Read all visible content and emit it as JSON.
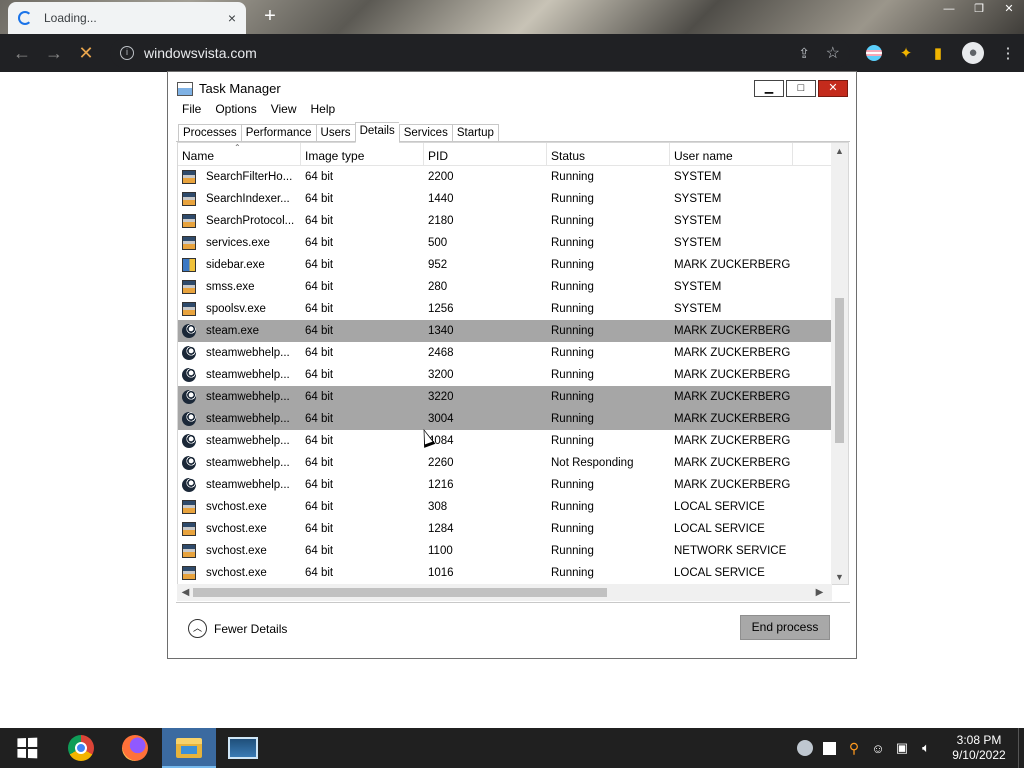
{
  "browser": {
    "tab_title": "Loading...",
    "tab_close": "×",
    "new_tab": "+",
    "url": "windowsvista.com",
    "win_min": "—",
    "win_restore": "❐",
    "win_close": "✕"
  },
  "taskmgr": {
    "title": "Task Manager",
    "menu": [
      "File",
      "Options",
      "View",
      "Help"
    ],
    "tabs": [
      "Processes",
      "Performance",
      "Users",
      "Details",
      "Services",
      "Startup"
    ],
    "active_tab": "Details",
    "columns": [
      "Name",
      "Image type",
      "PID",
      "Status",
      "User name"
    ],
    "rows": [
      {
        "icon": "system",
        "name": "SearchFilterHo...",
        "type": "64 bit",
        "pid": "2200",
        "status": "Running",
        "user": "SYSTEM",
        "selected": false
      },
      {
        "icon": "system",
        "name": "SearchIndexer...",
        "type": "64 bit",
        "pid": "1440",
        "status": "Running",
        "user": "SYSTEM",
        "selected": false
      },
      {
        "icon": "system",
        "name": "SearchProtocol...",
        "type": "64 bit",
        "pid": "2180",
        "status": "Running",
        "user": "SYSTEM",
        "selected": false
      },
      {
        "icon": "system",
        "name": "services.exe",
        "type": "64 bit",
        "pid": "500",
        "status": "Running",
        "user": "SYSTEM",
        "selected": false
      },
      {
        "icon": "sidebar",
        "name": "sidebar.exe",
        "type": "64 bit",
        "pid": "952",
        "status": "Running",
        "user": "MARK ZUCKERBERG",
        "selected": false
      },
      {
        "icon": "system",
        "name": "smss.exe",
        "type": "64 bit",
        "pid": "280",
        "status": "Running",
        "user": "SYSTEM",
        "selected": false
      },
      {
        "icon": "system",
        "name": "spoolsv.exe",
        "type": "64 bit",
        "pid": "1256",
        "status": "Running",
        "user": "SYSTEM",
        "selected": false
      },
      {
        "icon": "steam",
        "name": "steam.exe",
        "type": "64 bit",
        "pid": "1340",
        "status": "Running",
        "user": "MARK ZUCKERBERG",
        "selected": true
      },
      {
        "icon": "steam",
        "name": "steamwebhelp...",
        "type": "64 bit",
        "pid": "2468",
        "status": "Running",
        "user": "MARK ZUCKERBERG",
        "selected": false
      },
      {
        "icon": "steam",
        "name": "steamwebhelp...",
        "type": "64 bit",
        "pid": "3200",
        "status": "Running",
        "user": "MARK ZUCKERBERG",
        "selected": false
      },
      {
        "icon": "steam",
        "name": "steamwebhelp...",
        "type": "64 bit",
        "pid": "3220",
        "status": "Running",
        "user": "MARK ZUCKERBERG",
        "selected": true
      },
      {
        "icon": "steam",
        "name": "steamwebhelp...",
        "type": "64 bit",
        "pid": "3004",
        "status": "Running",
        "user": "MARK ZUCKERBERG",
        "selected": true
      },
      {
        "icon": "steam",
        "name": "steamwebhelp...",
        "type": "64 bit",
        "pid": "4084",
        "status": "Running",
        "user": "MARK ZUCKERBERG",
        "selected": false
      },
      {
        "icon": "steam",
        "name": "steamwebhelp...",
        "type": "64 bit",
        "pid": "2260",
        "status": "Not Responding",
        "user": "MARK ZUCKERBERG",
        "selected": false
      },
      {
        "icon": "steam",
        "name": "steamwebhelp...",
        "type": "64 bit",
        "pid": "1216",
        "status": "Running",
        "user": "MARK ZUCKERBERG",
        "selected": false
      },
      {
        "icon": "system",
        "name": "svchost.exe",
        "type": "64 bit",
        "pid": "308",
        "status": "Running",
        "user": "LOCAL SERVICE",
        "selected": false
      },
      {
        "icon": "system",
        "name": "svchost.exe",
        "type": "64 bit",
        "pid": "1284",
        "status": "Running",
        "user": "LOCAL SERVICE",
        "selected": false
      },
      {
        "icon": "system",
        "name": "svchost.exe",
        "type": "64 bit",
        "pid": "1100",
        "status": "Running",
        "user": "NETWORK SERVICE",
        "selected": false
      },
      {
        "icon": "system",
        "name": "svchost.exe",
        "type": "64 bit",
        "pid": "1016",
        "status": "Running",
        "user": "LOCAL SERVICE",
        "selected": false
      }
    ],
    "fewer_details": "Fewer Details",
    "end_process": "End process"
  },
  "taskbar": {
    "time": "3:08 PM",
    "date": "9/10/2022"
  },
  "icons": {
    "back": "back-arrow-icon",
    "forward": "forward-arrow-icon",
    "reload": "stop-loading-icon",
    "share": "share-icon",
    "star": "bookmark-star-icon"
  }
}
